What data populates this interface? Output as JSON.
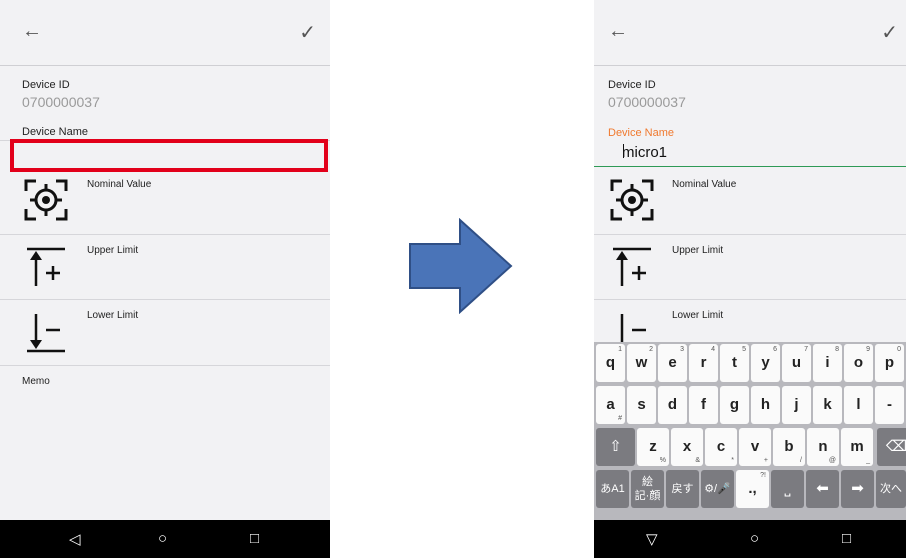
{
  "left": {
    "device_id_label": "Device ID",
    "device_id_value": "0700000037",
    "device_name_label": "Device Name",
    "device_name_value": "",
    "nominal_label": "Nominal Value",
    "upper_label": "Upper Limit",
    "lower_label": "Lower Limit",
    "memo_label": "Memo"
  },
  "right": {
    "device_id_label": "Device ID",
    "device_id_value": "0700000037",
    "device_name_label": "Device Name",
    "device_name_value": "micro1",
    "nominal_label": "Nominal Value",
    "upper_label": "Upper Limit",
    "lower_label": "Lower Limit"
  },
  "icons": {
    "back": "←",
    "check": "✓",
    "nav_back": "◁",
    "nav_home": "○",
    "nav_recent": "□",
    "nav_hide": "▽"
  },
  "colors": {
    "highlight": "#e2001a",
    "focus_label": "#f0792e",
    "focus_underline": "#2e9a56",
    "arrow": "#4a74b8"
  },
  "keyboard": {
    "row1": [
      {
        "k": "q",
        "n": "1"
      },
      {
        "k": "w",
        "n": "2"
      },
      {
        "k": "e",
        "n": "3"
      },
      {
        "k": "r",
        "n": "4"
      },
      {
        "k": "t",
        "n": "5"
      },
      {
        "k": "y",
        "n": "6"
      },
      {
        "k": "u",
        "n": "7"
      },
      {
        "k": "i",
        "n": "8"
      },
      {
        "k": "o",
        "n": "9"
      },
      {
        "k": "p",
        "n": "0"
      }
    ],
    "row2": [
      {
        "k": "a",
        "s": "#"
      },
      {
        "k": "s",
        "s": ""
      },
      {
        "k": "d",
        "s": ""
      },
      {
        "k": "f",
        "s": ""
      },
      {
        "k": "g",
        "s": ""
      },
      {
        "k": "h",
        "s": ""
      },
      {
        "k": "j",
        "s": ""
      },
      {
        "k": "k",
        "s": ""
      },
      {
        "k": "l",
        "s": ""
      },
      {
        "k": "-",
        "s": ""
      }
    ],
    "row3": [
      {
        "k": "z",
        "s": "%"
      },
      {
        "k": "x",
        "s": "&"
      },
      {
        "k": "c",
        "s": "*"
      },
      {
        "k": "v",
        "s": "+"
      },
      {
        "k": "b",
        "s": "/"
      },
      {
        "k": "n",
        "s": "@"
      },
      {
        "k": "m",
        "s": "_"
      }
    ],
    "shift": "⇧",
    "backspace": "⌫",
    "kana": "あA1",
    "emoji": "絵\n記·顔",
    "undo": "戻す",
    "settings_mic": "⚙/🎤",
    "punct": ".,",
    "punct_sup": "?!",
    "space": "⎵",
    "left_arrow": "⬅",
    "right_arrow": "➡",
    "next": "次へ"
  }
}
